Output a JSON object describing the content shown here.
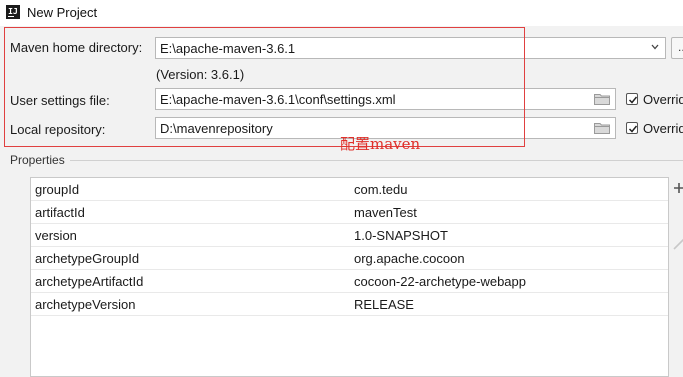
{
  "window": {
    "title": "New Project",
    "app_icon_text": "IJ"
  },
  "maven": {
    "home_label": "Maven home directory:",
    "home_value": "E:\\apache-maven-3.6.1",
    "version_text": "(Version: 3.6.1)",
    "browse_label": "...",
    "user_settings_label": "User settings file:",
    "user_settings_value": "E:\\apache-maven-3.6.1\\conf\\settings.xml",
    "local_repo_label": "Local repository:",
    "local_repo_value": "D:\\mavenrepository",
    "override_label": "Overrid"
  },
  "annotation": {
    "text": "配置maven",
    "color": "#e0302a"
  },
  "properties": {
    "title": "Properties",
    "rows": [
      {
        "key": "groupId",
        "value": "com.tedu"
      },
      {
        "key": "artifactId",
        "value": "mavenTest"
      },
      {
        "key": "version",
        "value": "1.0-SNAPSHOT"
      },
      {
        "key": "archetypeGroupId",
        "value": "org.apache.cocoon"
      },
      {
        "key": "archetypeArtifactId",
        "value": "cocoon-22-archetype-webapp"
      },
      {
        "key": "archetypeVersion",
        "value": "RELEASE"
      }
    ],
    "add_icon": "plus-icon",
    "remove_icon": "minus-icon"
  }
}
